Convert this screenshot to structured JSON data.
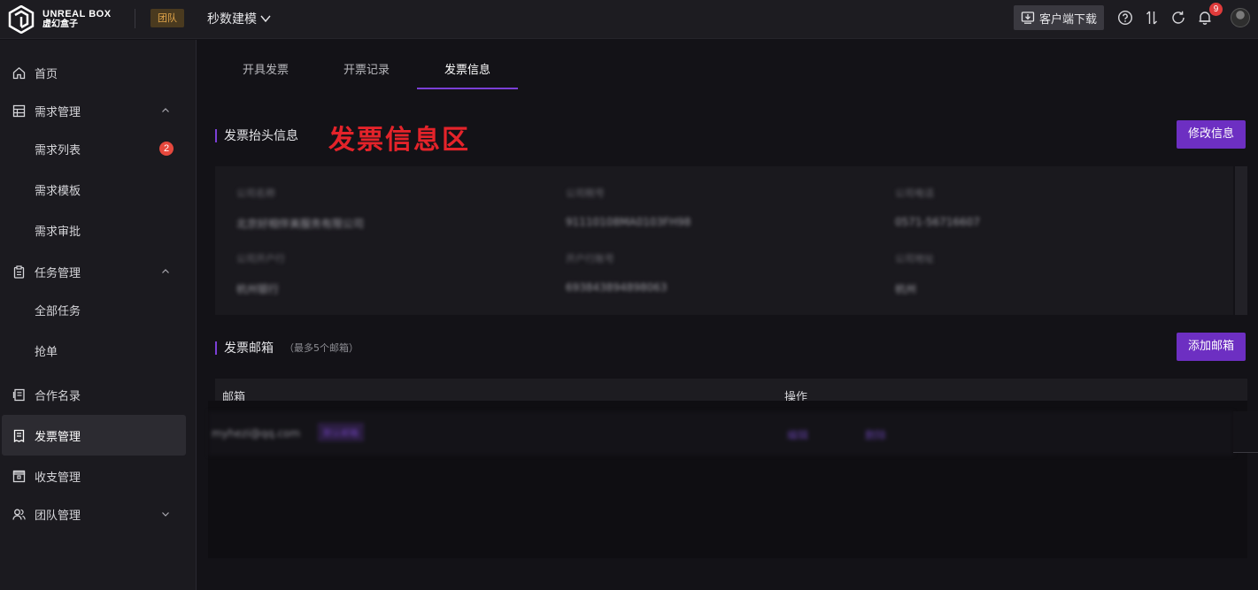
{
  "app": {
    "logo_en": "UNREAL BOX",
    "logo_cn": "虚幻盒子",
    "team_badge": "团队",
    "project": "秒数建模",
    "download": "客户端下载",
    "notification_count": "9",
    "accent": "#7b3fd6"
  },
  "sidebar": {
    "items": [
      {
        "label": "首页",
        "icon": "home-icon"
      },
      {
        "label": "需求管理",
        "icon": "table-icon"
      },
      {
        "label": "需求列表",
        "badge": "2"
      },
      {
        "label": "需求模板"
      },
      {
        "label": "需求审批"
      },
      {
        "label": "任务管理",
        "icon": "clipboard-icon"
      },
      {
        "label": "全部任务"
      },
      {
        "label": "抢单"
      },
      {
        "label": "合作名录",
        "icon": "book-icon"
      },
      {
        "label": "发票管理",
        "icon": "receipt-icon",
        "active": true
      },
      {
        "label": "收支管理",
        "icon": "wallet-icon"
      },
      {
        "label": "团队管理",
        "icon": "team-icon"
      }
    ]
  },
  "tabs": [
    {
      "label": "开具发票"
    },
    {
      "label": "开票记录"
    },
    {
      "label": "发票信息",
      "active": true
    }
  ],
  "invoice_header": {
    "title": "发票抬头信息",
    "annotation": "发票信息区",
    "edit_button": "修改信息",
    "fields": [
      {
        "label": "公司名称",
        "value": "北京好相伴美服务有限公司"
      },
      {
        "label": "公司税号",
        "value": "91110108MA0103FH98"
      },
      {
        "label": "公司电话",
        "value": "0571-56716607"
      },
      {
        "label": "公司开户行",
        "value": "杭州银行"
      },
      {
        "label": "开户行账号",
        "value": "693843894898063"
      },
      {
        "label": "公司地址",
        "value": "杭州"
      }
    ]
  },
  "invoice_email": {
    "title": "发票邮箱",
    "note": "（最多5个邮箱）",
    "add_button": "添加邮箱",
    "columns": [
      "邮箱",
      "操作"
    ],
    "rows": [
      {
        "email": "myhezi@qq.com",
        "tag": "默认邮箱",
        "edit": "编辑",
        "delete": "删除"
      }
    ]
  }
}
